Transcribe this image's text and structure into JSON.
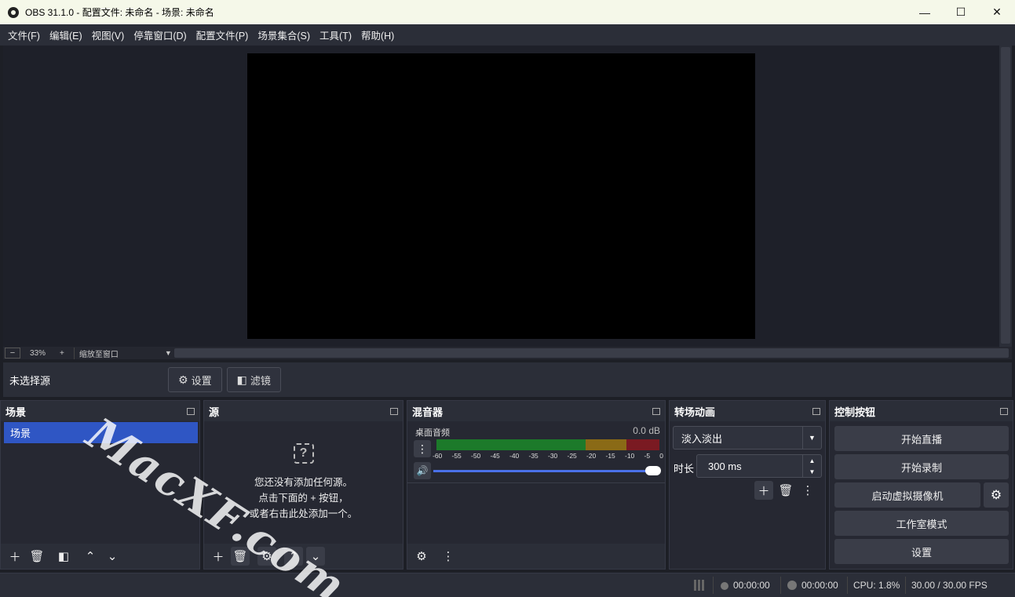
{
  "window": {
    "title": "OBS 31.1.0 - 配置文件: 未命名 - 场景: 未命名",
    "minimize": "—",
    "maximize": "☐",
    "close": "✕"
  },
  "menu": [
    "文件(F)",
    "编辑(E)",
    "视图(V)",
    "停靠窗口(D)",
    "配置文件(P)",
    "场景集合(S)",
    "工具(T)",
    "帮助(H)"
  ],
  "zoom": {
    "minus": "−",
    "value": "33%",
    "plus": "+",
    "mode": "缩放至窗口",
    "arrow": "▼"
  },
  "source_toolbar": {
    "no_source": "未选择源",
    "settings": "设置",
    "filters": "滤镜"
  },
  "scenes": {
    "title": "场景",
    "items": [
      "场景"
    ]
  },
  "sources": {
    "title": "源",
    "empty_line1": "您还没有添加任何源。",
    "empty_line2": "点击下面的 + 按钮，",
    "empty_line3": "或者右击此处添加一个。",
    "empty_icon": "?"
  },
  "mixer": {
    "title": "混音器",
    "source_name": "桌面音频",
    "db": "0.0 dB",
    "ticks": [
      "-60",
      "-55",
      "-50",
      "-45",
      "-40",
      "-35",
      "-30",
      "-25",
      "-20",
      "-15",
      "-10",
      "-5",
      "0"
    ],
    "volume_level": 1.0
  },
  "transitions": {
    "title": "转场动画",
    "selected": "淡入淡出",
    "duration_label": "时长",
    "duration_value": "300 ms"
  },
  "controls": {
    "title": "控制按钮",
    "start_stream": "开始直播",
    "start_record": "开始录制",
    "virtual_cam": "启动虚拟摄像机",
    "studio_mode": "工作室模式",
    "settings": "设置"
  },
  "status": {
    "stream_time": "00:00:00",
    "record_time": "00:00:00",
    "cpu": "CPU: 1.8%",
    "fps": "30.00 / 30.00 FPS"
  },
  "watermark": "MacXF.com"
}
